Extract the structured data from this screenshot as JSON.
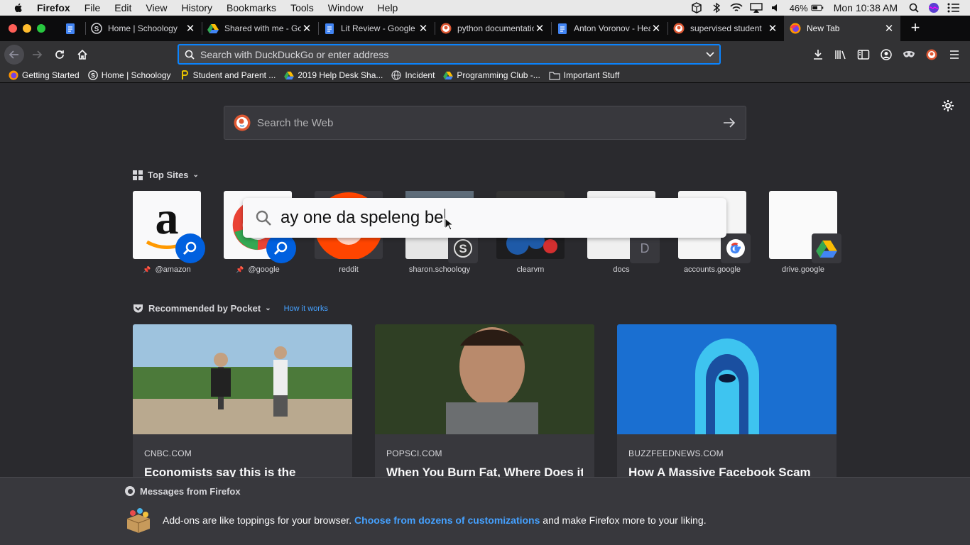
{
  "menubar": {
    "app_name": "Firefox",
    "menus": [
      "File",
      "Edit",
      "View",
      "History",
      "Bookmarks",
      "Tools",
      "Window",
      "Help"
    ],
    "battery": "46%",
    "clock": "Mon 10:38 AM"
  },
  "tabs": [
    {
      "title": "",
      "icon": "google-docs-icon",
      "pinned": true
    },
    {
      "title": "Home | Schoology",
      "icon": "schoology-icon"
    },
    {
      "title": "Shared with me - Goo",
      "icon": "google-drive-icon"
    },
    {
      "title": "Lit Review - Google Do",
      "icon": "google-docs-icon"
    },
    {
      "title": "python documentation",
      "icon": "duckduckgo-icon"
    },
    {
      "title": "Anton Voronov - Hea",
      "icon": "google-docs-icon"
    },
    {
      "title": "supervised student",
      "icon": "duckduckgo-icon"
    },
    {
      "title": "New Tab",
      "icon": "firefox-icon",
      "active": true
    }
  ],
  "urlbar": {
    "placeholder": "Search with DuckDuckGo or enter address",
    "value": ""
  },
  "bookmarks": [
    {
      "label": "Getting Started",
      "icon": "firefox-icon"
    },
    {
      "label": "Home | Schoology",
      "icon": "schoology-icon"
    },
    {
      "label": "Student and Parent ...",
      "icon": "pathway-icon"
    },
    {
      "label": "2019 Help Desk Sha...",
      "icon": "google-drive-icon"
    },
    {
      "label": "Incident",
      "icon": "globe-icon"
    },
    {
      "label": "Programming Club -...",
      "icon": "google-drive-icon"
    },
    {
      "label": "Important Stuff",
      "icon": "folder-icon"
    }
  ],
  "newtab": {
    "search_placeholder": "Search the Web",
    "top_sites_heading": "Top Sites",
    "top_sites": [
      {
        "label": "@amazon",
        "pinned": true
      },
      {
        "label": "@google",
        "pinned": true
      },
      {
        "label": "reddit"
      },
      {
        "label": "sharon.schoology"
      },
      {
        "label": "clearvm"
      },
      {
        "label": "docs",
        "letter": "D"
      },
      {
        "label": "accounts.google"
      },
      {
        "label": "drive.google"
      }
    ],
    "overlay_text": "ay one da speleng be",
    "pocket_heading": "Recommended by Pocket",
    "pocket_link": "How it works",
    "cards": [
      {
        "source": "CNBC.COM",
        "title": "Economists say this is the"
      },
      {
        "source": "POPSCI.COM",
        "title": "When You Burn Fat, Where Does it"
      },
      {
        "source": "BUZZFEEDNEWS.COM",
        "title": "How A Massive Facebook Scam"
      }
    ]
  },
  "messages": {
    "heading": "Messages from Firefox",
    "text_before": "Add-ons are like toppings for your browser.",
    "link_text": "Choose from dozens of customizations",
    "text_after": "and make Firefox more to your liking."
  },
  "colors": {
    "accent": "#0a84ff",
    "link": "#45a1ff",
    "background": "#2a2a2e"
  }
}
